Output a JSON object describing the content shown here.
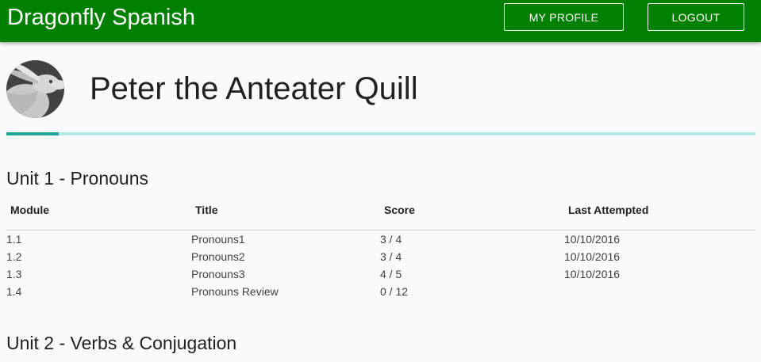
{
  "app": {
    "title": "Dragonfly Spanish"
  },
  "nav": {
    "profile_label": "MY PROFILE",
    "logout_label": "LOGOUT"
  },
  "colors": {
    "appbar": "#008000",
    "progress_fill": "#26a69a",
    "progress_track": "#b2ebe6"
  },
  "profile": {
    "name": "Peter the Anteater Quill",
    "avatar_icon": "rabbit-avatar-icon",
    "progress_fraction": 0.07
  },
  "table_headers": [
    "Module",
    "Title",
    "Score",
    "Last Attempted"
  ],
  "units": [
    {
      "title": "Unit 1 - Pronouns",
      "rows": [
        {
          "module": "1.1",
          "title": "Pronouns1",
          "score": "3 / 4",
          "last": "10/10/2016"
        },
        {
          "module": "1.2",
          "title": "Pronouns2",
          "score": "3 / 4",
          "last": "10/10/2016"
        },
        {
          "module": "1.3",
          "title": "Pronouns3",
          "score": "4 / 5",
          "last": "10/10/2016"
        },
        {
          "module": "1.4",
          "title": "Pronouns Review",
          "score": "0 / 12",
          "last": ""
        }
      ]
    },
    {
      "title": "Unit 2 - Verbs & Conjugation",
      "rows": []
    }
  ]
}
